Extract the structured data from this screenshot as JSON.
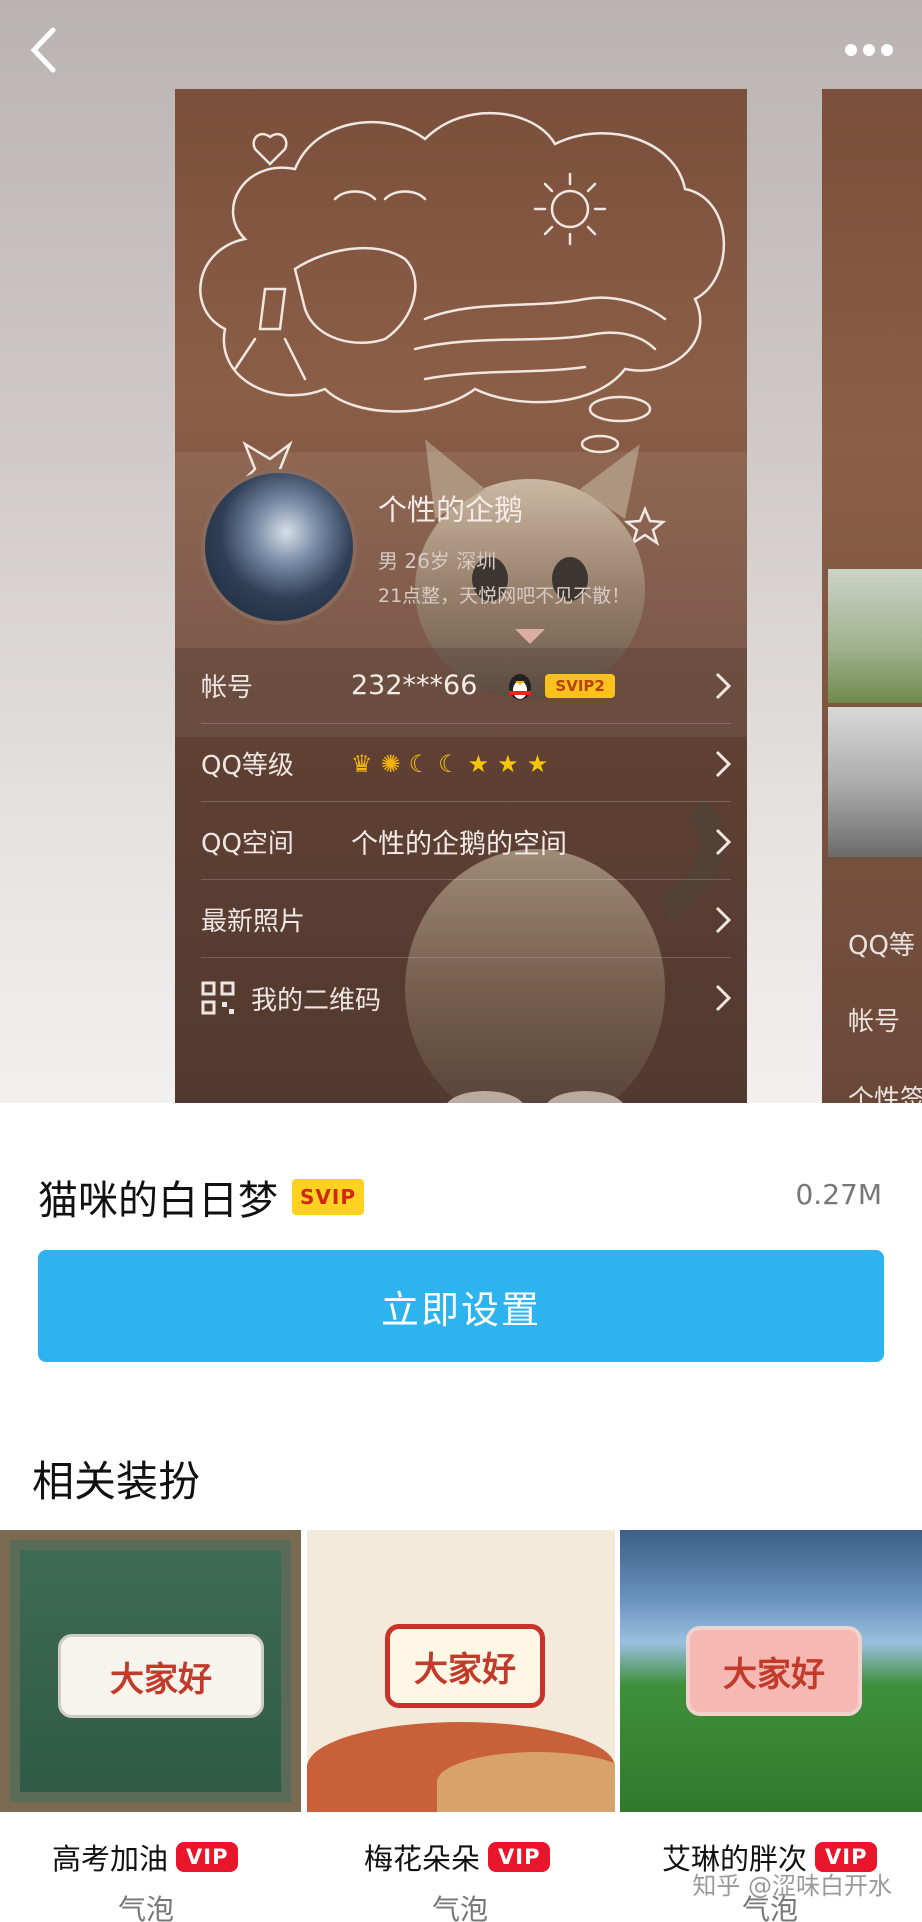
{
  "header": {
    "back_icon": "chevron-left-icon",
    "more_icon": "more-dots-icon"
  },
  "preview": {
    "profile": {
      "nickname": "个性的企鹅",
      "meta": "男  26岁  深圳",
      "signature": "21点整，天悦网吧不见不散！"
    },
    "rows": [
      {
        "label": "帐号",
        "value": "232***66",
        "badge": "SVIP2"
      },
      {
        "label": "QQ等级",
        "value": ""
      },
      {
        "label": "QQ空间",
        "value": "个性的企鹅的空间"
      },
      {
        "label": "最新照片",
        "value": ""
      },
      {
        "label": "我的二维码",
        "value": ""
      }
    ],
    "side_rows": [
      "QQ等",
      "帐号",
      "个性签"
    ]
  },
  "theme": {
    "title": "猫咪的白日梦",
    "badge": "SVIP",
    "size": "0.27M",
    "button_label": "立即设置"
  },
  "related": {
    "title": "相关装扮",
    "items": [
      {
        "name": "高考加油",
        "badge": "VIP",
        "type": "气泡",
        "bubble_text": "大家好"
      },
      {
        "name": "梅花朵朵",
        "badge": "VIP",
        "type": "气泡",
        "bubble_text": "大家好"
      },
      {
        "name": "艾琳的胖次",
        "badge": "VIP",
        "type": "气泡",
        "bubble_text": "大家好"
      }
    ]
  },
  "watermark": "知乎 @涩味白开水",
  "colors": {
    "accent": "#2db4ee",
    "svip_yellow": "#ffd21f",
    "vip_red": "#e9162b"
  }
}
